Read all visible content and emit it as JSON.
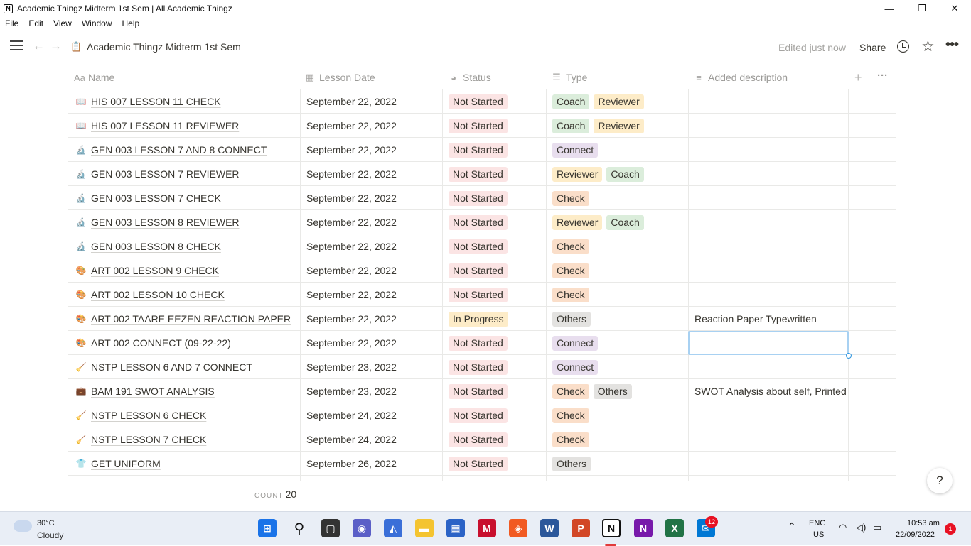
{
  "window": {
    "title": "Academic Thingz Midterm 1st Sem | All Academic Thingz",
    "app_icon": "N",
    "controls": {
      "minimize": "—",
      "maximize": "❐",
      "close": "✕"
    }
  },
  "menu": [
    "File",
    "Edit",
    "View",
    "Window",
    "Help"
  ],
  "topbar": {
    "page_icon": "📋",
    "page_title": "Academic Thingz Midterm 1st Sem",
    "edited": "Edited just now",
    "share": "Share"
  },
  "table": {
    "columns": [
      {
        "icon": "Aa",
        "label": "Name"
      },
      {
        "icon": "▦",
        "label": "Lesson Date"
      },
      {
        "icon": "◕",
        "label": "Status"
      },
      {
        "icon": "☰",
        "label": "Type"
      },
      {
        "icon": "≡",
        "label": "Added description"
      }
    ],
    "rows": [
      {
        "emoji": "📖",
        "name": "HIS 007 LESSON 11 CHECK",
        "date": "September 22, 2022",
        "status": "Not Started",
        "types": [
          "Coach",
          "Reviewer"
        ],
        "desc": ""
      },
      {
        "emoji": "📖",
        "name": "HIS 007 LESSON 11 REVIEWER",
        "date": "September 22, 2022",
        "status": "Not Started",
        "types": [
          "Coach",
          "Reviewer"
        ],
        "desc": ""
      },
      {
        "emoji": "🔬",
        "name": "GEN 003 LESSON 7 AND 8 CONNECT",
        "date": "September 22, 2022",
        "status": "Not Started",
        "types": [
          "Connect"
        ],
        "desc": ""
      },
      {
        "emoji": "🔬",
        "name": "GEN 003 LESSON 7 REVIEWER",
        "date": "September 22, 2022",
        "status": "Not Started",
        "types": [
          "Reviewer",
          "Coach"
        ],
        "desc": ""
      },
      {
        "emoji": "🔬",
        "name": "GEN 003 LESSON 7 CHECK",
        "date": "September 22, 2022",
        "status": "Not Started",
        "types": [
          "Check"
        ],
        "desc": ""
      },
      {
        "emoji": "🔬",
        "name": "GEN 003 LESSON 8 REVIEWER",
        "date": "September 22, 2022",
        "status": "Not Started",
        "types": [
          "Reviewer",
          "Coach"
        ],
        "desc": ""
      },
      {
        "emoji": "🔬",
        "name": "GEN 003 LESSON 8 CHECK",
        "date": "September 22, 2022",
        "status": "Not Started",
        "types": [
          "Check"
        ],
        "desc": ""
      },
      {
        "emoji": "🎨",
        "name": "ART 002 LESSON 9 CHECK",
        "date": "September 22, 2022",
        "status": "Not Started",
        "types": [
          "Check"
        ],
        "desc": ""
      },
      {
        "emoji": "🎨",
        "name": "ART 002 LESSON 10 CHECK",
        "date": "September 22, 2022",
        "status": "Not Started",
        "types": [
          "Check"
        ],
        "desc": ""
      },
      {
        "emoji": "🎨",
        "name": "ART 002 TAARE EEZEN REACTION PAPER",
        "date": "September 22, 2022",
        "status": "In Progress",
        "types": [
          "Others"
        ],
        "desc": "Reaction Paper Typewritten"
      },
      {
        "emoji": "🎨",
        "name": "ART 002 CONNECT (09-22-22)",
        "date": "September 22, 2022",
        "status": "Not Started",
        "types": [
          "Connect"
        ],
        "desc": ""
      },
      {
        "emoji": "🧹",
        "name": "NSTP LESSON 6 AND 7 CONNECT",
        "date": "September 23, 2022",
        "status": "Not Started",
        "types": [
          "Connect"
        ],
        "desc": ""
      },
      {
        "emoji": "💼",
        "name": "BAM 191 SWOT ANALYSIS",
        "date": "September 23, 2022",
        "status": "Not Started",
        "types": [
          "Check",
          "Others"
        ],
        "desc": "SWOT Analysis about self, Printed"
      },
      {
        "emoji": "🧹",
        "name": "NSTP LESSON 6 CHECK",
        "date": "September 24, 2022",
        "status": "Not Started",
        "types": [
          "Check"
        ],
        "desc": ""
      },
      {
        "emoji": "🧹",
        "name": "NSTP LESSON 7 CHECK",
        "date": "September 24, 2022",
        "status": "Not Started",
        "types": [
          "Check"
        ],
        "desc": ""
      },
      {
        "emoji": "👕",
        "name": "GET UNIFORM",
        "date": "September 26, 2022",
        "status": "Not Started",
        "types": [
          "Others"
        ],
        "desc": ""
      }
    ],
    "count_label": "COUNT",
    "count_value": "20"
  },
  "colors": {
    "Not Started": "#fbe4e4",
    "In Progress": "#fdecc8",
    "Coach": "#dbeddb",
    "Reviewer": "#fdecc8",
    "Connect": "#e8deee",
    "Check": "#fadec9",
    "Others": "#e3e2e0"
  },
  "help": "?",
  "taskbar": {
    "temp": "30°C",
    "condition": "Cloudy",
    "lang": "ENG",
    "region": "US",
    "time": "10:53 am",
    "date": "22/09/2022",
    "mail_badge": "12",
    "notif_badge": "1"
  }
}
